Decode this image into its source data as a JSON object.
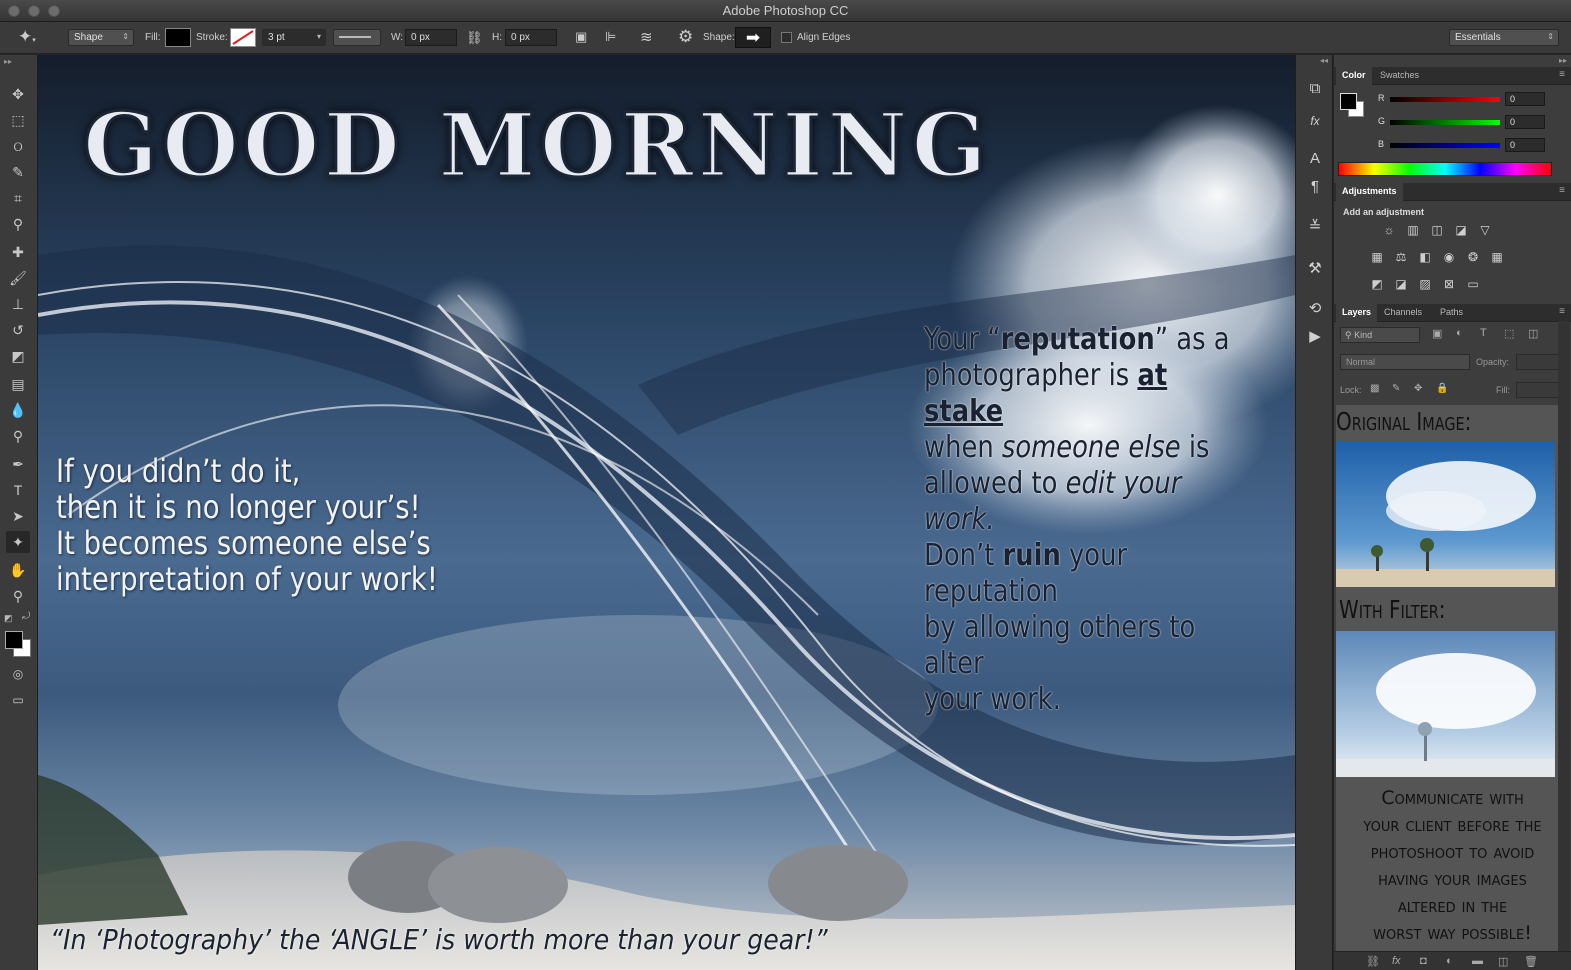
{
  "window": {
    "title": "Adobe Photoshop CC"
  },
  "options_bar": {
    "mode": "Shape",
    "fill_label": "Fill:",
    "stroke_label": "Stroke:",
    "stroke_width": "3 pt",
    "w_label": "W:",
    "w_value": "0 px",
    "h_label": "H:",
    "h_value": "0 px",
    "shape_label": "Shape:",
    "align_edges_label": "Align Edges",
    "workspace": "Essentials"
  },
  "canvas": {
    "headline": "GOOD MORNING",
    "left_quote": [
      "If you didn’t do it,",
      "then it is no longer your’s!",
      "It becomes someone else’s",
      "interpretation of your work!"
    ],
    "right_quote": {
      "l1a": "Your “",
      "l1b": "reputation",
      "l1c": "” as a",
      "l2a": "photographer is ",
      "l2b": "at stake",
      "l3a": "when ",
      "l3b": "someone else",
      "l3c": " is",
      "l4a": "allowed to ",
      "l4b": "edit your work.",
      "l5a": "Don’t ",
      "l5b": "ruin",
      "l5c": " your reputation",
      "l6": "by allowing others to alter",
      "l7": "your work."
    },
    "bottom_quote": "“In ‘Photography’ the ‘ANGLE’ is worth more than your gear!”"
  },
  "color_panel": {
    "tabs": [
      "Color",
      "Swatches"
    ],
    "channels": [
      {
        "name": "R",
        "value": "0"
      },
      {
        "name": "G",
        "value": "0"
      },
      {
        "name": "B",
        "value": "0"
      }
    ]
  },
  "adjustments_panel": {
    "tab": "Adjustments",
    "heading": "Add an adjustment"
  },
  "layers_panel": {
    "tabs": [
      "Layers",
      "Channels",
      "Paths"
    ],
    "kind_label": "Kind",
    "blend_mode": "Normal",
    "opacity_label": "Opacity:",
    "lock_label": "Lock:",
    "fill_label": "Fill:"
  },
  "side_notes": {
    "original_label": "Original Image:",
    "filter_label": "With Filter:",
    "communicate": [
      "Communicate with",
      "your client before the",
      "photoshoot to avoid",
      "having your images",
      "altered in the",
      "worst way possible!"
    ]
  }
}
